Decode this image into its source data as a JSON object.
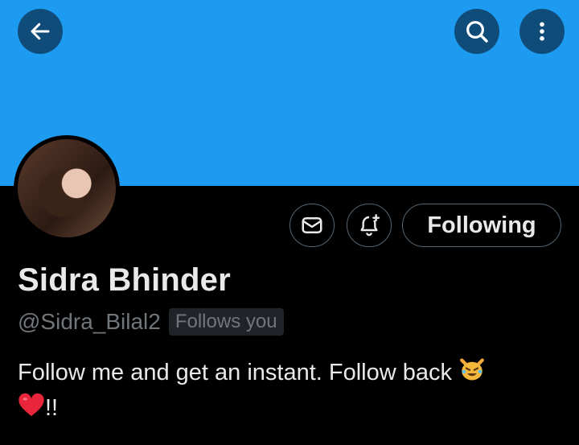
{
  "header": {
    "back_icon": "arrow-left-icon",
    "search_icon": "search-icon",
    "more_icon": "more-vertical-icon",
    "banner_color": "#1d9bf0"
  },
  "profile": {
    "name": "Sidra Bhinder",
    "handle": "@Sidra_Bilal2",
    "follows_you": "Follows you",
    "bio_text": "Follow me and get an instant. Follow back",
    "bio_emoji_1": "😹",
    "bio_emoji_2": "❤️",
    "bio_tail": "!!"
  },
  "actions": {
    "message_icon": "envelope-icon",
    "notify_icon": "bell-plus-icon",
    "following_label": "Following"
  }
}
